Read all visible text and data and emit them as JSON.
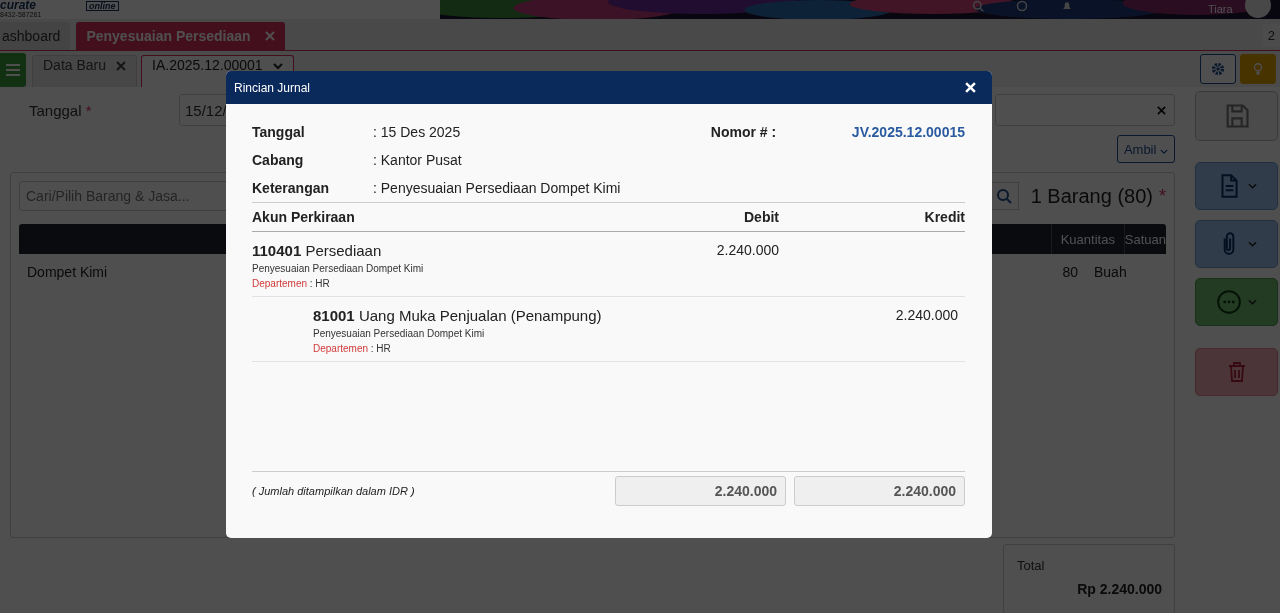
{
  "header": {
    "brand": "curate",
    "brand_sub": "online",
    "phone": "8432-587261",
    "user": "Tiara"
  },
  "tabs": [
    {
      "label": "ashboard",
      "selected": false,
      "closable": false
    },
    {
      "label": "Penyesuaian Persediaan",
      "selected": true,
      "closable": true
    }
  ],
  "tab_count": "2",
  "subtabs": [
    {
      "label": "Data Baru",
      "selected": false
    },
    {
      "label": "IA.2025.12.00001",
      "selected": true
    }
  ],
  "form": {
    "date_label": "Tanggal",
    "required_mark": "*",
    "date_value": "15/12/",
    "fetch_button": "Ambil"
  },
  "items": {
    "search_placeholder": "Cari/Pilih Barang & Jasa...",
    "count": "1 Barang (80)",
    "required_mark": "*",
    "columns": [
      "Kuantitas",
      "Satuan"
    ],
    "rows": [
      {
        "name": "Dompet Kimi",
        "quantity": "80",
        "unit": "Buah"
      }
    ]
  },
  "total": {
    "label": "Total",
    "value": "Rp 2.240.000"
  },
  "modal": {
    "title": "Rincian Jurnal",
    "info": [
      {
        "label": "Tanggal",
        "value": ": 15 Des 2025"
      },
      {
        "label": "Cabang",
        "value": ": Kantor Pusat"
      },
      {
        "label": "Keterangan",
        "value": ": Penyesuaian Persediaan Dompet Kimi"
      }
    ],
    "number_label": "Nomor # :",
    "number": "JV.2025.12.00015",
    "columns": [
      "Akun Perkiraan",
      "Debit",
      "Kredit"
    ],
    "entries": [
      {
        "kind": "debit",
        "code": "110401",
        "name": "Persediaan",
        "memo": "Penyesuaian Persediaan Dompet Kimi",
        "dept_label": "Departemen",
        "dept": ": HR",
        "amount": "2.240.000"
      },
      {
        "kind": "credit",
        "code": "81001",
        "name": "Uang Muka Penjualan (Penampung)",
        "memo": "Penyesuaian Persediaan Dompet Kimi",
        "dept_label": "Departemen",
        "dept": ": HR",
        "amount": "2.240.000"
      }
    ],
    "note": "( Jumlah ditampilkan dalam IDR )",
    "total_debit": "2.240.000",
    "total_credit": "2.240.000"
  }
}
